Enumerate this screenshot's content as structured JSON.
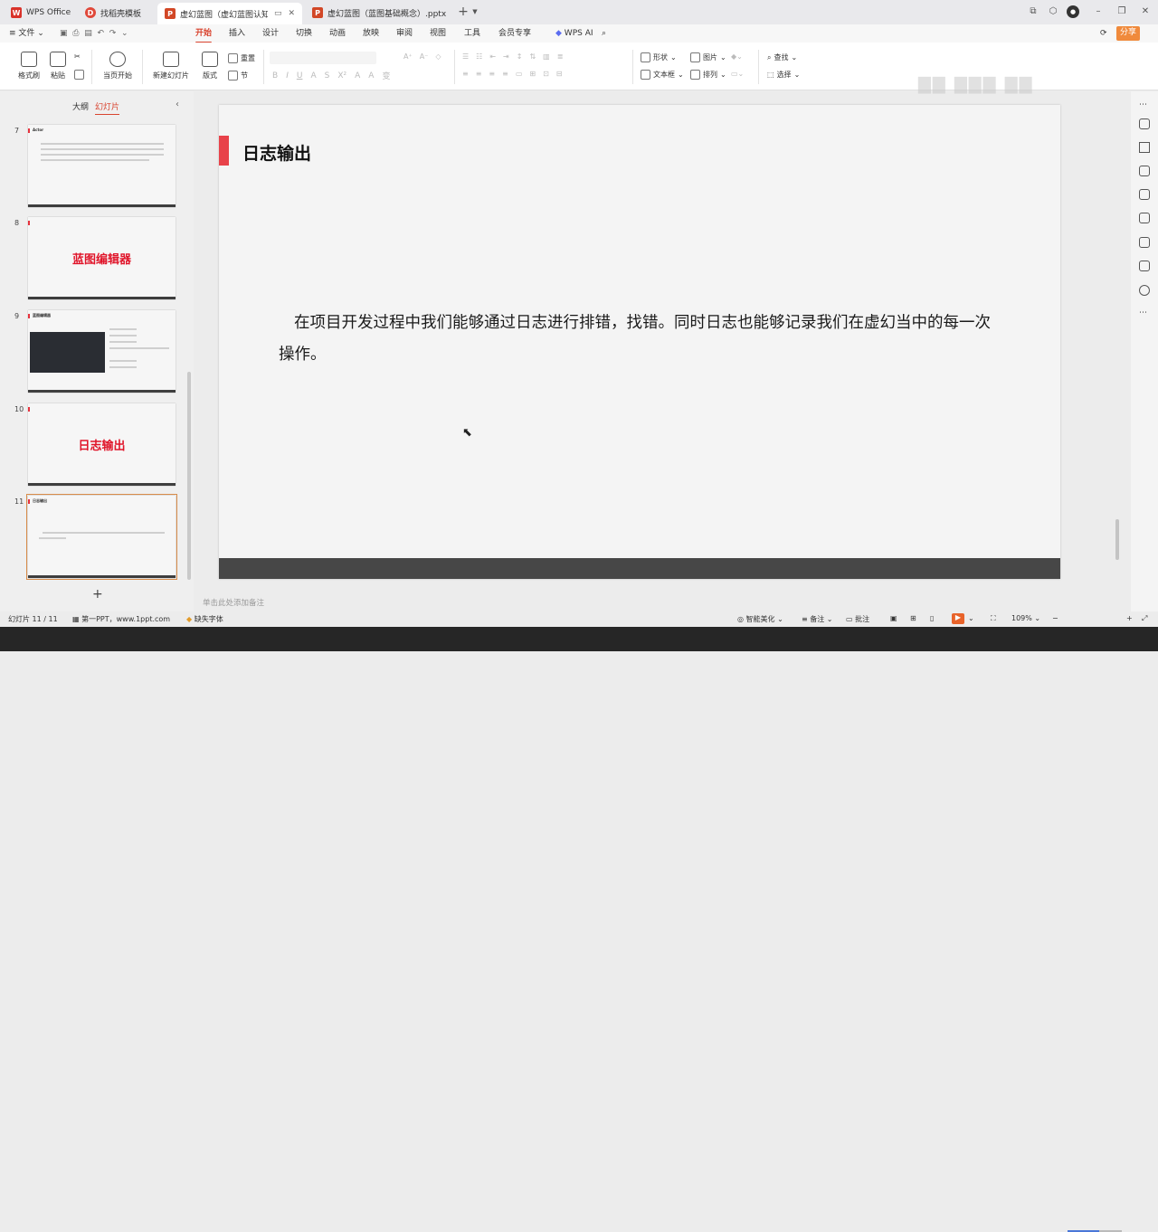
{
  "tabs": [
    {
      "label": "WPS Office",
      "icon": "wps-logo"
    },
    {
      "label": "找稻壳模板",
      "icon": "docer-icon"
    },
    {
      "label": "虚幻蓝图（虚幻蓝图认知）.pp",
      "icon": "ppt-icon",
      "active": true
    },
    {
      "label": "虚幻蓝图（蓝图基础概念）.pptx",
      "icon": "ppt-icon"
    }
  ],
  "menu": {
    "file": "文件",
    "items": [
      "开始",
      "插入",
      "设计",
      "切换",
      "动画",
      "放映",
      "审阅",
      "视图",
      "工具",
      "会员专享"
    ],
    "active": "开始",
    "wps_ai": "WPS AI",
    "share": "分享"
  },
  "ribbon": {
    "format_painter": "格式刷",
    "paste": "粘贴",
    "from_current": "当页开始",
    "new_slide": "新建幻灯片",
    "layout": "版式",
    "reset": "重置",
    "section": "节",
    "shape": "形状",
    "picture": "图片",
    "textbox": "文本框",
    "arrange": "排列",
    "find": "查找",
    "select": "选择"
  },
  "left_panel": {
    "tab_outline": "大纲",
    "tab_slides": "幻灯片",
    "slides": [
      {
        "num": "7",
        "title": "Actor"
      },
      {
        "num": "8",
        "big": "蓝图编辑器"
      },
      {
        "num": "9",
        "title": "蓝图编辑器"
      },
      {
        "num": "10",
        "big": "日志输出"
      },
      {
        "num": "11",
        "title": "日志输出",
        "selected": true
      }
    ],
    "add": "+"
  },
  "slide": {
    "title": "日志输出",
    "body": "在项目开发过程中我们能够通过日志进行排错，找错。同时日志也能够记录我们在虚幻当中的每一次操作。",
    "accent_color": "#e8424a"
  },
  "notes_placeholder": "单击此处添加备注",
  "status": {
    "slide_counter": "幻灯片 11 / 11",
    "theme": "第一PPT，www.1ppt.com",
    "missing_font": "缺失字体",
    "beautify": "智能美化",
    "notes": "备注",
    "comments": "批注",
    "zoom": "109%"
  }
}
